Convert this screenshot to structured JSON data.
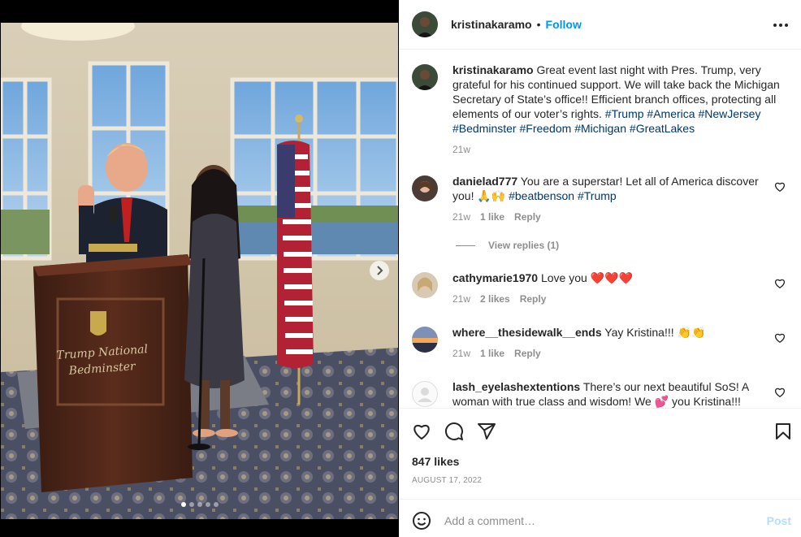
{
  "post": {
    "author": "kristinakaramo",
    "separator": "•",
    "follow_label": "Follow",
    "caption": {
      "username": "kristinakaramo",
      "text": "Great event last night with Pres. Trump, very grateful for his continued support. We will take back the Michigan Secretary of State’s office!! Efficient branch offices, protecting all elements of our voter’s rights.",
      "hashtags": [
        "#Trump",
        "#America",
        "#NewJersey",
        "#Bedminster",
        "#Freedom",
        "#Michigan",
        "#GreatLakes"
      ],
      "time": "21w"
    },
    "likes": "847 likes",
    "date": "AUGUST 17, 2022"
  },
  "media": {
    "podium_text_line1": "Trump National",
    "podium_text_line2": "Bedminster",
    "carousel_count": 5,
    "carousel_active": 1
  },
  "comments": [
    {
      "username": "danielad777",
      "text": "You are a superstar! Let all of America discover you! 🙏🙌",
      "hashtags": [
        "#beatbenson",
        "#Trump"
      ],
      "time": "21w",
      "likes": "1 like",
      "reply": "Reply",
      "view_replies": "View replies (1)"
    },
    {
      "username": "cathymarie1970",
      "text": "Love you ❤️❤️❤️",
      "time": "21w",
      "likes": "2 likes",
      "reply": "Reply"
    },
    {
      "username": "where__thesidewalk__ends",
      "text": "Yay Kristina!!! 👏👏",
      "time": "21w",
      "likes": "1 like",
      "reply": "Reply"
    },
    {
      "username": "lash_eyelashextentions",
      "text": "There’s our next beautiful SoS! A woman with true class and wisdom! We 💕 you Kristina!!!"
    }
  ],
  "add_comment": {
    "placeholder": "Add a comment…",
    "post_label": "Post"
  },
  "colors": {
    "link": "#0095f6",
    "hashtag": "#00376b",
    "muted": "#8e8e8e",
    "post_disabled": "#b2dffc"
  },
  "icons": {
    "like": "heart-icon",
    "comment": "comment-icon",
    "share": "send-icon",
    "save": "bookmark-icon",
    "more": "more-options-icon",
    "emoji": "emoji-icon",
    "next": "chevron-right-icon"
  }
}
